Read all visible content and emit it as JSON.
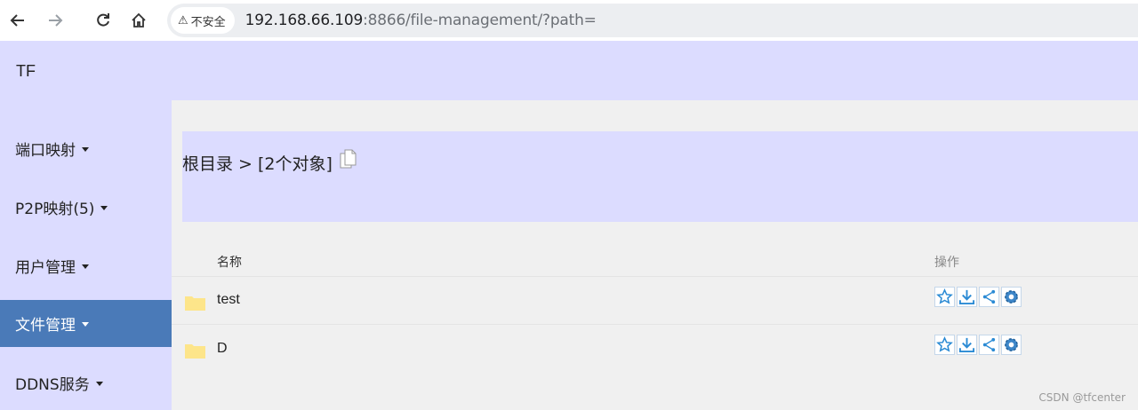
{
  "browser": {
    "security_label": "不安全",
    "url_host": "192.168.66.109",
    "url_rest": ":8866/file-management/?path="
  },
  "app": {
    "brand": "TF"
  },
  "sidebar": {
    "items": [
      {
        "label": "端口映射",
        "active": false
      },
      {
        "label": "P2P映射(5)",
        "active": false
      },
      {
        "label": "用户管理",
        "active": false
      },
      {
        "label": "文件管理",
        "active": true
      },
      {
        "label": "DDNS服务",
        "active": false
      }
    ]
  },
  "breadcrumb": {
    "text": "根目录 > [2个对象]"
  },
  "table": {
    "headers": {
      "name": "名称",
      "ops": "操作"
    },
    "rows": [
      {
        "name": "test",
        "type": "folder"
      },
      {
        "name": "D",
        "type": "folder"
      }
    ]
  },
  "colors": {
    "accent": "#4a7ab8",
    "panel": "#dcdcff",
    "folder": "#fde58a"
  },
  "watermark": "CSDN @tfcenter"
}
